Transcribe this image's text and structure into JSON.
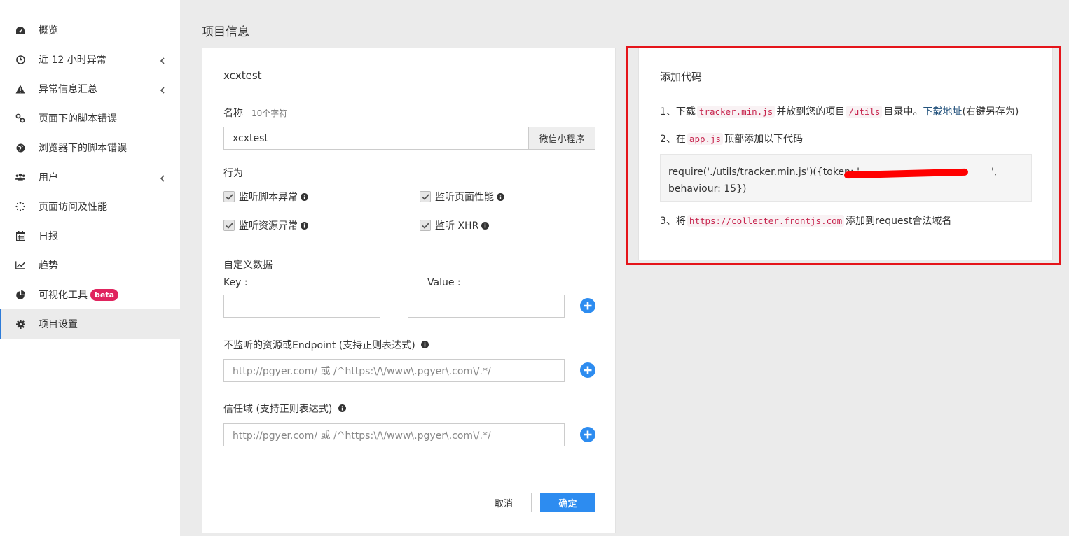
{
  "sidebar": {
    "items": [
      {
        "label": "概览",
        "icon": "dashboard-icon"
      },
      {
        "label": "近 12 小时异常",
        "icon": "clock-icon",
        "expandable": true
      },
      {
        "label": "异常信息汇总",
        "icon": "warning-icon",
        "expandable": true
      },
      {
        "label": "页面下的脚本错误",
        "icon": "link-icon"
      },
      {
        "label": "浏览器下的脚本错误",
        "icon": "globe-icon"
      },
      {
        "label": "用户",
        "icon": "users-icon",
        "expandable": true
      },
      {
        "label": "页面访问及性能",
        "icon": "spinner-icon"
      },
      {
        "label": "日报",
        "icon": "calendar-icon"
      },
      {
        "label": "趋势",
        "icon": "line-chart-icon"
      },
      {
        "label": "可视化工具",
        "icon": "pie-chart-icon",
        "badge": "beta"
      },
      {
        "label": "项目设置",
        "icon": "gear-icon",
        "active": true
      }
    ]
  },
  "page_title": "项目信息",
  "project_form": {
    "project_name": "xcxtest",
    "name_label": "名称",
    "name_hint": "10个字符",
    "name_value": "xcxtest",
    "platform_addon": "微信小程序",
    "behavior_label": "行为",
    "behaviors": [
      {
        "label": "监听脚本异常",
        "checked": true
      },
      {
        "label": "监听页面性能",
        "checked": true
      },
      {
        "label": "监听资源异常",
        "checked": true
      },
      {
        "label": "监听 XHR",
        "checked": true
      }
    ],
    "custom_data_label": "自定义数据",
    "key_label": "Key :",
    "value_label": "Value :",
    "key_value": "",
    "value_value": "",
    "ignore_label": "不监听的资源或Endpoint (支持正则表达式)",
    "ignore_placeholder": "http://pgyer.com/ 或 /^https:\\/\\/www\\.pgyer\\.com\\/.*/",
    "trust_label": "信任域 (支持正则表达式)",
    "trust_placeholder": "http://pgyer.com/ 或 /^https:\\/\\/www\\.pgyer\\.com\\/.*/",
    "cancel_label": "取消",
    "ok_label": "确定"
  },
  "code_panel": {
    "title": "添加代码",
    "step1_prefix": "1、下载",
    "step1_file": "tracker.min.js",
    "step1_mid": "并放到您的项目",
    "step1_dir": "/utils",
    "step1_suffix": "目录中。",
    "step1_link": "下载地址",
    "step1_note": "(右键另存为)",
    "step2_prefix": "2、在",
    "step2_file": "app.js",
    "step2_suffix": "顶部添加以下代码",
    "code_line1": "require('./utils/tracker.min.js')({token: '",
    "code_line1_end": "',",
    "code_line2": "behaviour: 15})",
    "step3_prefix": "3、将",
    "step3_url": "https://collecter.frontjs.com",
    "step3_suffix": "添加到request合法域名"
  },
  "colors": {
    "accent": "#2d8cf0",
    "highlight_border": "#e5141a",
    "badge": "#e0245e"
  }
}
